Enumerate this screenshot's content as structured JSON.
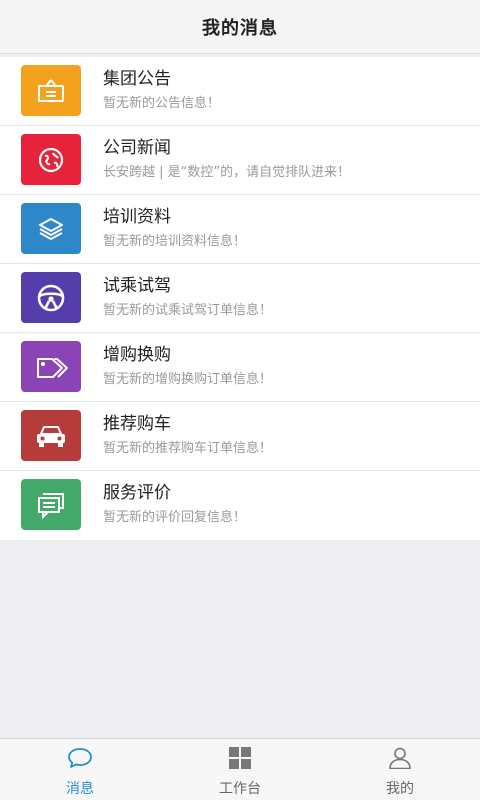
{
  "header": {
    "title": "我的消息"
  },
  "messages": [
    {
      "title": "集团公告",
      "subtitle": "暂无新的公告信息！",
      "icon": "announcement-board-icon",
      "color": "#f4a21d"
    },
    {
      "title": "公司新闻",
      "subtitle": "长安跨越 | 是“数控”的，请自觉排队进来！",
      "icon": "globe-news-icon",
      "color": "#e7223b"
    },
    {
      "title": "培训资料",
      "subtitle": "暂无新的培训资料信息！",
      "icon": "layers-icon",
      "color": "#2d87c8"
    },
    {
      "title": "试乘试驾",
      "subtitle": "暂无新的试乘试驾订单信息！",
      "icon": "steering-wheel-icon",
      "color": "#553eab"
    },
    {
      "title": "增购换购",
      "subtitle": "暂无新的增购换购订单信息！",
      "icon": "tags-icon",
      "color": "#8a44b6"
    },
    {
      "title": "推荐购车",
      "subtitle": "暂无新的推荐购车订单信息！",
      "icon": "car-icon",
      "color": "#b63b3b"
    },
    {
      "title": "服务评价",
      "subtitle": "暂无新的评价回复信息！",
      "icon": "chat-review-icon",
      "color": "#43a96a"
    }
  ],
  "tabs": [
    {
      "label": "消息",
      "icon": "chat-bubble-icon",
      "active": true
    },
    {
      "label": "工作台",
      "icon": "grid-icon",
      "active": false
    },
    {
      "label": "我的",
      "icon": "user-icon",
      "active": false
    }
  ],
  "colors": {
    "tab_active": "#1e8ed6",
    "tab_inactive": "#888888"
  }
}
